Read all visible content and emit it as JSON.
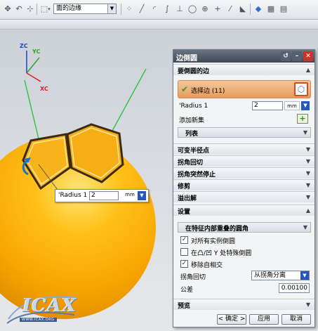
{
  "toolbar": {
    "filter_value": "面的边缘",
    "icons": [
      "move-icon",
      "undo-icon",
      "snap-icon",
      "selection-box-icon",
      "dropdown-arrow-icon",
      "point-snap-icon",
      "line-icon",
      "arc-icon",
      "curve-icon",
      "normal-icon",
      "circle-icon",
      "tangent-icon",
      "cross-icon",
      "extend-icon",
      "cube-icon",
      "view-icon",
      "layer-icon"
    ]
  },
  "viewport": {
    "axes": {
      "zc": "ZC",
      "yc": "YC",
      "xc": "XC"
    },
    "radius_popup": {
      "label": "Radius 1",
      "value": "2",
      "unit": "mm"
    },
    "watermark": {
      "logo": "ICAX",
      "url": "WWW.ICAX.ORG"
    }
  },
  "dialog": {
    "title": "边倒圆",
    "sections": {
      "edges_to_blend": "要倒圆的边",
      "variable_radius": "可变半径点",
      "corner_setback": "拐角回切",
      "corner_stop": "拐角突然停止",
      "trim": "修剪",
      "overflow": "溢出解",
      "settings": "设置",
      "preview": "预览"
    },
    "select_edge": "选择边 (11)",
    "radius_label": "Radius 1",
    "radius_value": "2",
    "radius_unit": "mm",
    "add_new_set": "添加新集",
    "list": "列表",
    "settings": {
      "sub_header": "在特征内部重叠的圆角",
      "options": [
        {
          "label": "对所有实例倒圆",
          "checked": true
        },
        {
          "label": "在凸/凹 Y 处特殊倒圆",
          "checked": false
        },
        {
          "label": "移除自相交",
          "checked": true
        }
      ],
      "corner_setback_label": "拐角回切",
      "corner_setback_value": "从拐角分离",
      "tolerance_label": "公差",
      "tolerance_value": "0.00100"
    },
    "buttons": {
      "ok": "< 确定 >",
      "apply": "应用",
      "cancel": "取消"
    }
  },
  "colors": {
    "accent_blue": "#2857b8",
    "selection_orange": "#e79b5a",
    "sphere": "#f7a400",
    "edge_green": "#2cc23a"
  }
}
